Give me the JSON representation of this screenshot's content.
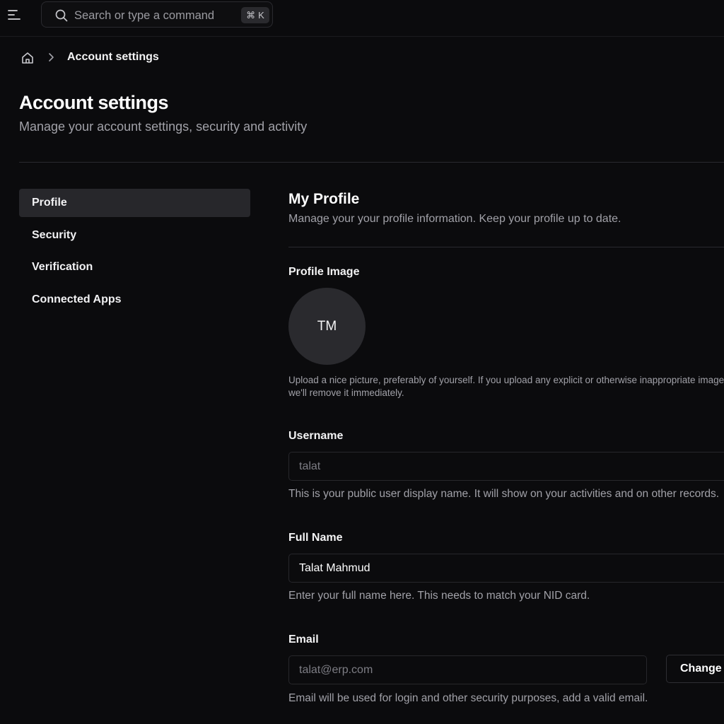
{
  "topbar": {
    "search_placeholder": "Search or type a command",
    "shortcut_symbol": "⌘",
    "shortcut_key": "K"
  },
  "breadcrumb": {
    "current": "Account settings"
  },
  "header": {
    "title": "Account settings",
    "subtitle": "Manage your account settings, security and activity"
  },
  "sidebar": {
    "items": [
      {
        "label": "Profile",
        "active": true
      },
      {
        "label": "Security"
      },
      {
        "label": "Verification"
      },
      {
        "label": "Connected Apps"
      }
    ]
  },
  "profile": {
    "title": "My Profile",
    "description": "Manage your your profile information. Keep your profile up to date.",
    "image_label": "Profile Image",
    "avatar_initials": "TM",
    "image_help": "Upload a nice picture, preferably of yourself. If you upload any explicit or otherwise inappropriate image, we'll remove it immediately.",
    "username": {
      "label": "Username",
      "value": "talat",
      "help": "This is your public user display name. It will show on your activities and on other records."
    },
    "full_name": {
      "label": "Full Name",
      "value": "Talat Mahmud",
      "help": "Enter your full name here. This needs to match your NID card."
    },
    "email": {
      "label": "Email",
      "value": "talat@erp.com",
      "change_label": "Change",
      "help": "Email will be used for login and other security purposes, add a valid email."
    }
  },
  "colors": {
    "background": "#0b0b0d",
    "active_nav": "#27272b",
    "muted_text": "#a1a1a8",
    "border": "#2a2a2f"
  }
}
